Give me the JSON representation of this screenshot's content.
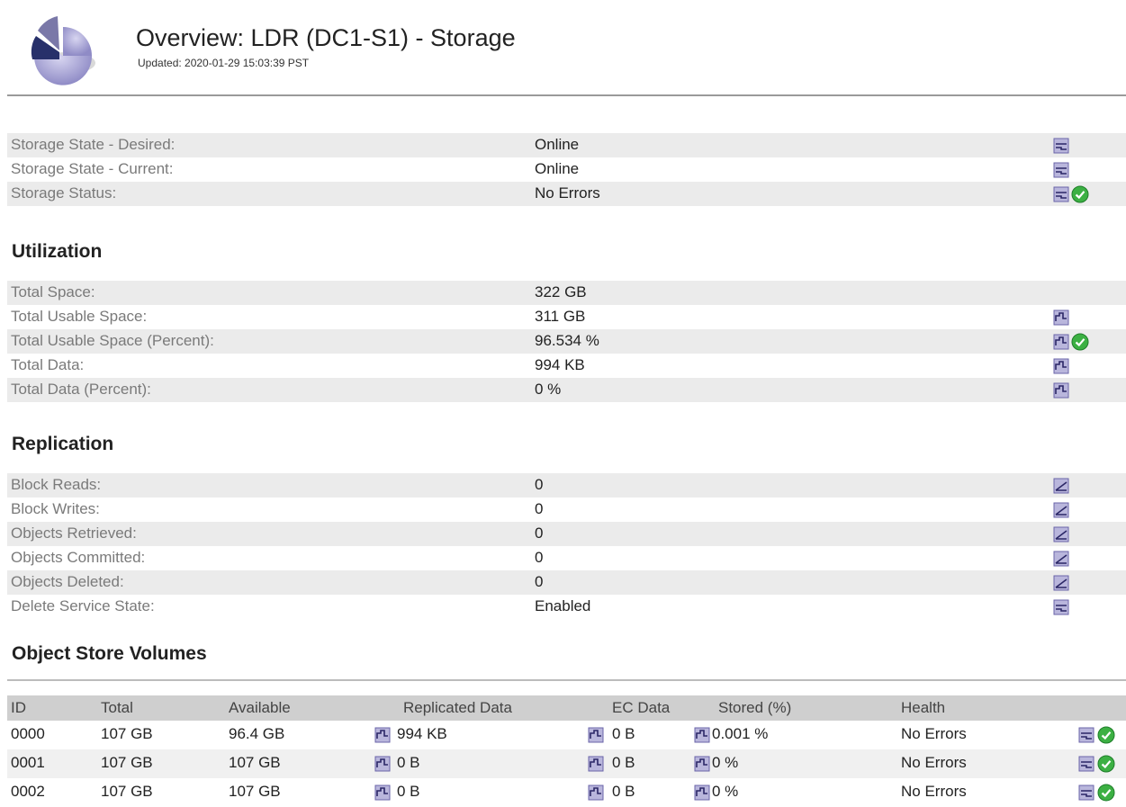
{
  "header": {
    "title": "Overview: LDR (DC1-S1) - Storage",
    "updated": "Updated: 2020-01-29 15:03:39 PST",
    "logo_icon": "pie-chart-icon"
  },
  "storage": {
    "rows": [
      {
        "label": "Storage State - Desired:",
        "value": "Online",
        "chart_icon": "state-chart-icon",
        "status": null
      },
      {
        "label": "Storage State - Current:",
        "value": "Online",
        "chart_icon": "state-chart-icon",
        "status": null
      },
      {
        "label": "Storage Status:",
        "value": "No Errors",
        "chart_icon": "state-chart-icon",
        "status": "ok"
      }
    ]
  },
  "utilization": {
    "title": "Utilization",
    "rows": [
      {
        "label": "Total Space:",
        "value": "322 GB",
        "chart_icon": null,
        "status": null
      },
      {
        "label": "Total Usable Space:",
        "value": "311 GB",
        "chart_icon": "chart-icon",
        "status": null
      },
      {
        "label": "Total Usable Space (Percent):",
        "value": "96.534 %",
        "chart_icon": "chart-icon",
        "status": "ok"
      },
      {
        "label": "Total Data:",
        "value": "994 KB",
        "chart_icon": "chart-icon",
        "status": null
      },
      {
        "label": "Total Data (Percent):",
        "value": "0 %",
        "chart_icon": "chart-icon",
        "status": null
      }
    ]
  },
  "replication": {
    "title": "Replication",
    "rows": [
      {
        "label": "Block Reads:",
        "value": "0",
        "chart_icon": "trend-chart-icon",
        "status": null
      },
      {
        "label": "Block Writes:",
        "value": "0",
        "chart_icon": "trend-chart-icon",
        "status": null
      },
      {
        "label": "Objects Retrieved:",
        "value": "0",
        "chart_icon": "trend-chart-icon",
        "status": null
      },
      {
        "label": "Objects Committed:",
        "value": "0",
        "chart_icon": "trend-chart-icon",
        "status": null
      },
      {
        "label": "Objects Deleted:",
        "value": "0",
        "chart_icon": "trend-chart-icon",
        "status": null
      },
      {
        "label": "Delete Service State:",
        "value": "Enabled",
        "chart_icon": "state-chart-icon",
        "status": null
      }
    ]
  },
  "volumes": {
    "title": "Object Store Volumes",
    "headers": [
      "ID",
      "Total",
      "Available",
      "Replicated Data",
      "EC Data",
      "Stored (%)",
      "Health"
    ],
    "rows": [
      {
        "id": "0000",
        "total": "107 GB",
        "available": "96.4 GB",
        "replicated": "994 KB",
        "ec": "0 B",
        "stored": "0.001 %",
        "health": "No Errors"
      },
      {
        "id": "0001",
        "total": "107 GB",
        "available": "107 GB",
        "replicated": "0 B",
        "ec": "0 B",
        "stored": "0 %",
        "health": "No Errors"
      },
      {
        "id": "0002",
        "total": "107 GB",
        "available": "107 GB",
        "replicated": "0 B",
        "ec": "0 B",
        "stored": "0 %",
        "health": "No Errors"
      }
    ]
  },
  "colors": {
    "status_ok": "#3cb043",
    "icon_fill": "#b9b6dc",
    "icon_border": "#6a64a8",
    "row_stripe": "#ebebeb",
    "label_gray": "#7a7a7a"
  }
}
